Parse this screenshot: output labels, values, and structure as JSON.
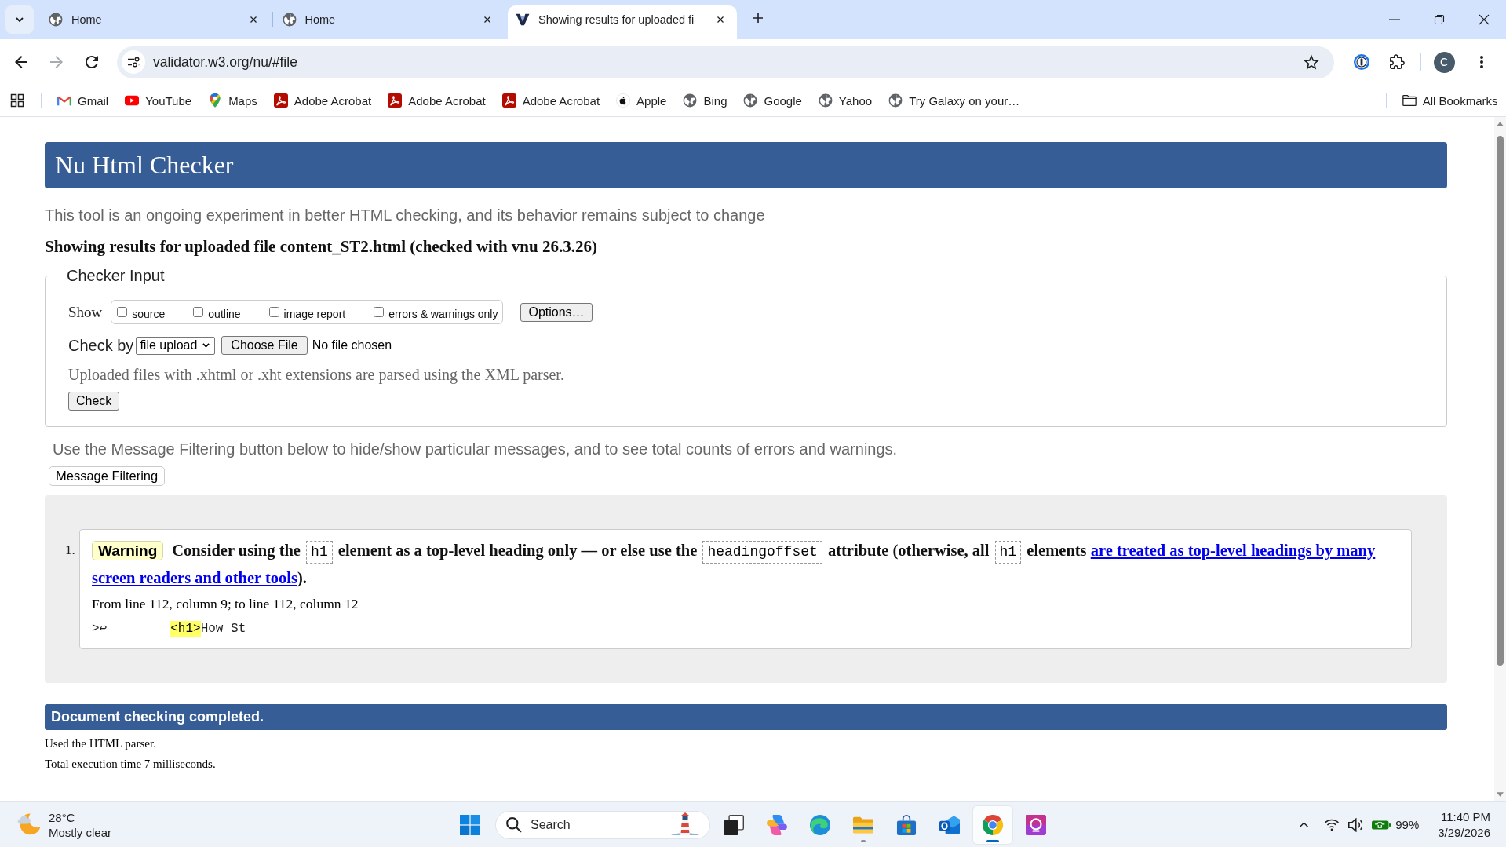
{
  "browser": {
    "tabs": [
      {
        "title": "Home",
        "kind": "globe",
        "selected": false
      },
      {
        "title": "Home",
        "kind": "globe",
        "selected": false
      },
      {
        "title": "Showing results for uploaded fi",
        "kind": "validator",
        "selected": true
      }
    ],
    "back_disabled": false,
    "forward_disabled": true,
    "address": "validator.w3.org/nu/#file",
    "profile_initial": "C",
    "bookmarks": [
      {
        "label": "Gmail",
        "kind": "gmail"
      },
      {
        "label": "YouTube",
        "kind": "youtube"
      },
      {
        "label": "Maps",
        "kind": "maps"
      },
      {
        "label": "Adobe Acrobat",
        "kind": "acrobat"
      },
      {
        "label": "Adobe Acrobat",
        "kind": "acrobat"
      },
      {
        "label": "Adobe Acrobat",
        "kind": "acrobat"
      },
      {
        "label": "Apple",
        "kind": "apple"
      },
      {
        "label": "Bing",
        "kind": "globe"
      },
      {
        "label": "Google",
        "kind": "globe"
      },
      {
        "label": "Yahoo",
        "kind": "globe"
      },
      {
        "label": "Try Galaxy on your…",
        "kind": "globe"
      }
    ],
    "all_bookmarks": "All Bookmarks"
  },
  "page": {
    "title": "Nu Html Checker",
    "intro": "This tool is an ongoing experiment in better HTML checking, and its behavior remains subject to change",
    "results_heading": "Showing results for uploaded file content_ST2.html (checked with vnu 26.3.26)",
    "checker_input": {
      "legend": "Checker Input",
      "show_label": "Show",
      "show_options": [
        {
          "label": "source",
          "checked": false
        },
        {
          "label": "outline",
          "checked": false
        },
        {
          "label": "image report",
          "checked": false
        },
        {
          "label": "errors & warnings only",
          "checked": false
        }
      ],
      "options_button": "Options…",
      "check_by_label": "Check by",
      "check_by_value": "file upload",
      "choose_file_button": "Choose File",
      "file_status": "No file chosen",
      "note": "Uploaded files with .xhtml or .xht extensions are parsed using the XML parser.",
      "check_button": "Check"
    },
    "filter_hint": "Use the Message Filtering button below to hide/show particular messages, and to see total counts of errors and warnings.",
    "filter_button": "Message Filtering",
    "messages": [
      {
        "number": "1.",
        "kind": "warning",
        "badge": "Warning",
        "text_lines": [
          [
            {
              "kind": "text",
              "text": "Consider using the"
            },
            {
              "kind": "code",
              "text": "h1"
            },
            {
              "kind": "text",
              "text": "element as a top-level heading only — or else use the"
            },
            {
              "kind": "code",
              "text": "headingoffset"
            },
            {
              "kind": "text",
              "text": "attribute (otherwise, all"
            },
            {
              "kind": "code",
              "text": "h1"
            },
            {
              "kind": "text",
              "text": "elements"
            },
            {
              "kind": "link",
              "text": "are treated as top-level headings by many"
            }
          ],
          [
            {
              "kind": "link",
              "text": "screen readers and other tools"
            },
            {
              "kind": "punctuation",
              "text": ")."
            }
          ]
        ],
        "location": "From line 112, column 9; to line 112, column 12",
        "extract": {
          "before": ">",
          "line_break": "↩",
          "highlight": "<h1>",
          "after": "How St"
        }
      }
    ],
    "completion": {
      "title": "Document checking completed.",
      "details": [
        "Used the HTML parser.",
        "Total execution time 7 milliseconds."
      ]
    }
  },
  "taskbar": {
    "weather": {
      "temperature": "28°C",
      "condition": "Mostly clear"
    },
    "search": {
      "placeholder": "Search"
    },
    "apps": [
      {
        "kind": "task-view",
        "running": false,
        "selected": false
      },
      {
        "kind": "copilot",
        "running": false,
        "selected": false
      },
      {
        "kind": "edge",
        "running": false,
        "selected": false
      },
      {
        "kind": "explorer",
        "running": true,
        "selected": false
      },
      {
        "kind": "store",
        "running": false,
        "selected": false
      },
      {
        "kind": "outlook",
        "running": false,
        "selected": false
      },
      {
        "kind": "chrome",
        "running": true,
        "selected": true
      },
      {
        "kind": "purple-app",
        "running": false,
        "selected": false
      }
    ],
    "battery": "99%",
    "time": "11:40 PM",
    "date": "3/29/2026"
  }
}
